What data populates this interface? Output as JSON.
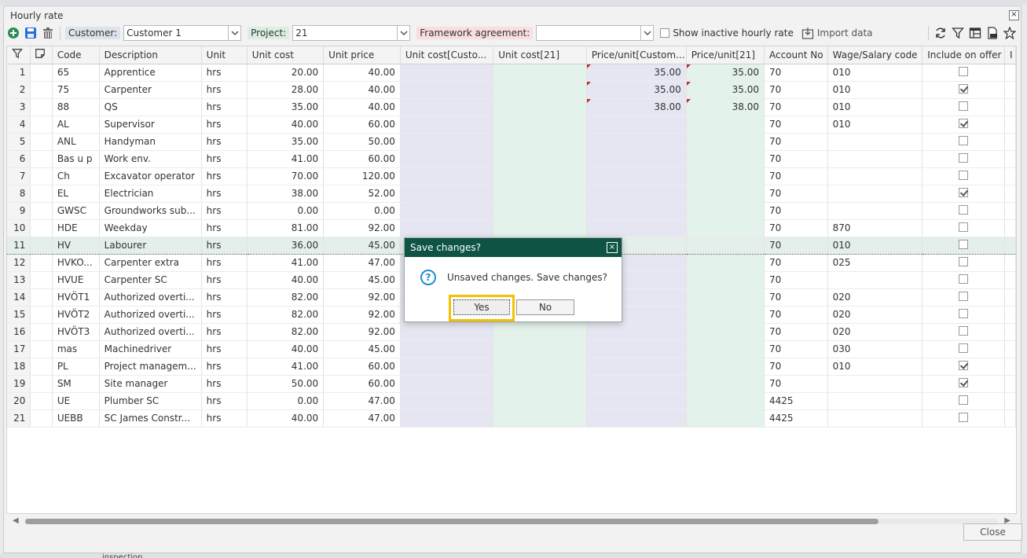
{
  "window": {
    "title": "Hourly rate",
    "close_label": "×"
  },
  "bottom_fragment": "inspection",
  "toolbar": {
    "customer_label": "Customer:",
    "customer_value": "Customer 1",
    "project_label": "Project:",
    "project_value": "21",
    "framework_label": "Framework agreement:",
    "framework_value": "",
    "show_inactive_label": "Show inactive hourly rate",
    "import_label": "Import data"
  },
  "columns": [
    "Code",
    "Description",
    "Unit",
    "Unit cost",
    "Unit price",
    "Unit cost[Custo...",
    "Unit cost[21]",
    "Price/unit[Custom...",
    "Price/unit[21]",
    "Account No",
    "Wage/Salary code",
    "Include on offer",
    "I"
  ],
  "rows": [
    {
      "n": "1",
      "code": "65",
      "desc": "Apprentice",
      "unit": "hrs",
      "cost": "20.00",
      "price": "40.00",
      "pc": "35.00",
      "p21": "35.00",
      "acc": "70",
      "wage": "010",
      "inc": false,
      "flag": true
    },
    {
      "n": "2",
      "code": "75",
      "desc": "Carpenter",
      "unit": "hrs",
      "cost": "28.00",
      "price": "40.00",
      "pc": "35.00",
      "p21": "35.00",
      "acc": "70",
      "wage": "010",
      "inc": true,
      "flag": true
    },
    {
      "n": "3",
      "code": "88",
      "desc": "QS",
      "unit": "hrs",
      "cost": "35.00",
      "price": "40.00",
      "pc": "38.00",
      "p21": "38.00",
      "acc": "70",
      "wage": "010",
      "inc": false,
      "flag": true
    },
    {
      "n": "4",
      "code": "AL",
      "desc": "Supervisor",
      "unit": "hrs",
      "cost": "40.00",
      "price": "60.00",
      "pc": "",
      "p21": "",
      "acc": "70",
      "wage": "010",
      "inc": true
    },
    {
      "n": "5",
      "code": "ANL",
      "desc": "Handyman",
      "unit": "hrs",
      "cost": "35.00",
      "price": "50.00",
      "pc": "",
      "p21": "",
      "acc": "70",
      "wage": "",
      "inc": false
    },
    {
      "n": "6",
      "code": "Bas u p",
      "desc": "Work env.",
      "unit": "hrs",
      "cost": "41.00",
      "price": "60.00",
      "pc": "",
      "p21": "",
      "acc": "70",
      "wage": "",
      "inc": false
    },
    {
      "n": "7",
      "code": "Ch",
      "desc": "Excavator operator",
      "unit": "hrs",
      "cost": "70.00",
      "price": "120.00",
      "pc": "",
      "p21": "",
      "acc": "70",
      "wage": "",
      "inc": false
    },
    {
      "n": "8",
      "code": "EL",
      "desc": "Electrician",
      "unit": "hrs",
      "cost": "38.00",
      "price": "52.00",
      "pc": "",
      "p21": "",
      "acc": "70",
      "wage": "",
      "inc": true
    },
    {
      "n": "9",
      "code": "GWSC",
      "desc": "Groundworks sub...",
      "unit": "hrs",
      "cost": "0.00",
      "price": "0.00",
      "pc": "",
      "p21": "",
      "acc": "70",
      "wage": "",
      "inc": false
    },
    {
      "n": "10",
      "code": "HDE",
      "desc": "Weekday",
      "unit": "hrs",
      "cost": "81.00",
      "price": "92.00",
      "pc": "",
      "p21": "",
      "acc": "70",
      "wage": "870",
      "inc": false
    },
    {
      "n": "11",
      "code": "HV",
      "desc": "Labourer",
      "unit": "hrs",
      "cost": "36.00",
      "price": "45.00",
      "pc": "",
      "p21": "",
      "acc": "70",
      "wage": "010",
      "inc": false,
      "sel": true
    },
    {
      "n": "12",
      "code": "HVKO...",
      "desc": "Carpenter extra",
      "unit": "hrs",
      "cost": "41.00",
      "price": "47.00",
      "pc": "",
      "p21": "",
      "acc": "70",
      "wage": "025",
      "inc": false
    },
    {
      "n": "13",
      "code": "HVUE",
      "desc": "Carpenter SC",
      "unit": "hrs",
      "cost": "40.00",
      "price": "45.00",
      "pc": "",
      "p21": "",
      "acc": "70",
      "wage": "",
      "inc": false
    },
    {
      "n": "14",
      "code": "HVÖT1",
      "desc": "Authorized overti...",
      "unit": "hrs",
      "cost": "82.00",
      "price": "92.00",
      "pc": "",
      "p21": "",
      "acc": "70",
      "wage": "020",
      "inc": false
    },
    {
      "n": "15",
      "code": "HVÖT2",
      "desc": "Authorized overti...",
      "unit": "hrs",
      "cost": "82.00",
      "price": "92.00",
      "pc": "",
      "p21": "",
      "acc": "70",
      "wage": "020",
      "inc": false
    },
    {
      "n": "16",
      "code": "HVÖT3",
      "desc": "Authorized overti...",
      "unit": "hrs",
      "cost": "82.00",
      "price": "92.00",
      "pc": "",
      "p21": "",
      "acc": "70",
      "wage": "020",
      "inc": false
    },
    {
      "n": "17",
      "code": "mas",
      "desc": "Machinedriver",
      "unit": "hrs",
      "cost": "40.00",
      "price": "45.00",
      "pc": "",
      "p21": "",
      "acc": "70",
      "wage": "030",
      "inc": false
    },
    {
      "n": "18",
      "code": "PL",
      "desc": "Project managem...",
      "unit": "hrs",
      "cost": "41.00",
      "price": "60.00",
      "pc": "",
      "p21": "",
      "acc": "70",
      "wage": "010",
      "inc": true
    },
    {
      "n": "19",
      "code": "SM",
      "desc": "Site manager",
      "unit": "hrs",
      "cost": "50.00",
      "price": "60.00",
      "pc": "",
      "p21": "",
      "acc": "70",
      "wage": "",
      "inc": true
    },
    {
      "n": "20",
      "code": "UE",
      "desc": "Plumber SC",
      "unit": "hrs",
      "cost": "0.00",
      "price": "47.00",
      "pc": "",
      "p21": "",
      "acc": "4425",
      "wage": "",
      "inc": false
    },
    {
      "n": "21",
      "code": "UEBB",
      "desc": "SC James Constr...",
      "unit": "hrs",
      "cost": "40.00",
      "price": "47.00",
      "pc": "",
      "p21": "",
      "acc": "4425",
      "wage": "",
      "inc": false
    }
  ],
  "footer": {
    "close_label": "Close"
  },
  "dialog": {
    "title": "Save changes?",
    "message": "Unsaved changes. Save changes?",
    "yes_label": "Yes",
    "no_label": "No",
    "close_label": "×",
    "q_glyph": "?"
  },
  "colors": {
    "dialog_header": "#0e5344",
    "highlight": "#f5c000",
    "lavender_col": "#e6e6f2",
    "mint_col": "#e3f2ea"
  }
}
